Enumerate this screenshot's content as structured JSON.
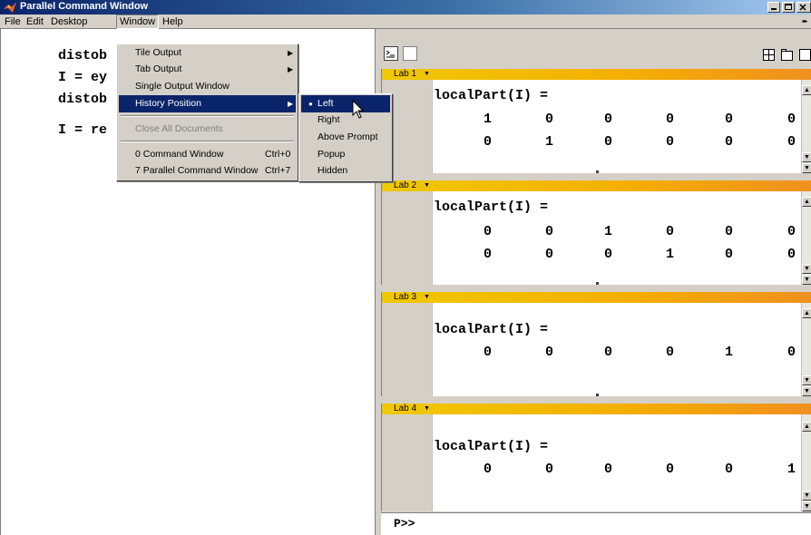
{
  "window": {
    "title": "Parallel Command Window"
  },
  "menubar": {
    "items": [
      "File",
      "Edit",
      "Desktop",
      "Window",
      "Help"
    ]
  },
  "left_pane": {
    "lines": [
      "distob",
      "I = ey",
      "distob",
      "I = re"
    ]
  },
  "window_menu": {
    "tile_output": "Tile Output",
    "tab_output": "Tab Output",
    "single_output": "Single Output Window",
    "history_position": "History Position",
    "close_all": "Close All Documents",
    "command_window": "0 Command Window",
    "command_window_shortcut": "Ctrl+0",
    "parallel_window": "7 Parallel Command Window",
    "parallel_window_shortcut": "Ctrl+7"
  },
  "history_submenu": {
    "items": [
      "Left",
      "Right",
      "Above Prompt",
      "Popup",
      "Hidden"
    ],
    "selected": "Left"
  },
  "labs": [
    {
      "name": "Lab 1",
      "label": "localPart(I) =",
      "rows": [
        [
          "1",
          "0",
          "0",
          "0",
          "0",
          "0"
        ],
        [
          "0",
          "1",
          "0",
          "0",
          "0",
          "0"
        ]
      ]
    },
    {
      "name": "Lab 2",
      "label": "localPart(I) =",
      "rows": [
        [
          "0",
          "0",
          "1",
          "0",
          "0",
          "0"
        ],
        [
          "0",
          "0",
          "0",
          "1",
          "0",
          "0"
        ]
      ]
    },
    {
      "name": "Lab 3",
      "label": "localPart(I) =",
      "rows": [
        [
          "0",
          "0",
          "0",
          "0",
          "1",
          "0"
        ]
      ]
    },
    {
      "name": "Lab 4",
      "label": "localPart(I) =",
      "rows": [
        [
          "0",
          "0",
          "0",
          "0",
          "0",
          "1"
        ]
      ]
    }
  ],
  "prompt": "P>>",
  "colors": {
    "title_bar": "#0a246a",
    "lab_header": "#f4b000",
    "menu_highlight": "#0a246a"
  }
}
